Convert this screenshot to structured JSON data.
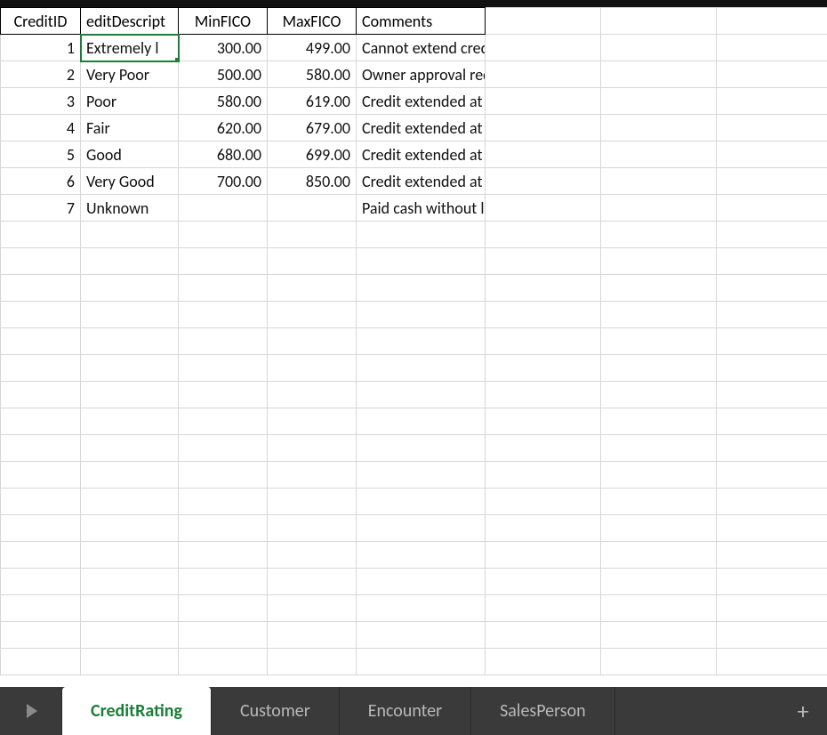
{
  "columns": {
    "widths": [
      90,
      110,
      100,
      100,
      145,
      130,
      130,
      130
    ],
    "headers": [
      "CreditID",
      "editDescript",
      "MinFICO",
      "MaxFICO",
      "Comments"
    ]
  },
  "rows": [
    {
      "id": "1",
      "desc": "Extremely l",
      "min": "300.00",
      "max": "499.00",
      "comment": "Cannot extend credit"
    },
    {
      "id": "2",
      "desc": "Very Poor",
      "min": "500.00",
      "max": "580.00",
      "comment": "Owner approval required to extend credit"
    },
    {
      "id": "3",
      "desc": "Poor",
      "min": "580.00",
      "max": "619.00",
      "comment": "Credit extended at extremely high interest rates"
    },
    {
      "id": "4",
      "desc": "Fair",
      "min": "620.00",
      "max": "679.00",
      "comment": "Credit extended at high interest rates"
    },
    {
      "id": "5",
      "desc": "Good",
      "min": "680.00",
      "max": "699.00",
      "comment": "Credit extended at normal interest rates"
    },
    {
      "id": "6",
      "desc": "Very Good",
      "min": "700.00",
      "max": "850.00",
      "comment": "Credit extended at low interest rates"
    },
    {
      "id": "7",
      "desc": "Unknown",
      "min": "",
      "max": "",
      "comment": "Paid cash without looking into financing options"
    }
  ],
  "empty_row_count": 17,
  "selected_cell": {
    "row": 1,
    "col": 2
  },
  "tabs": {
    "items": [
      "CreditRating",
      "Customer",
      "Encounter",
      "SalesPerson"
    ],
    "active_index": 0,
    "add_label": "+"
  }
}
